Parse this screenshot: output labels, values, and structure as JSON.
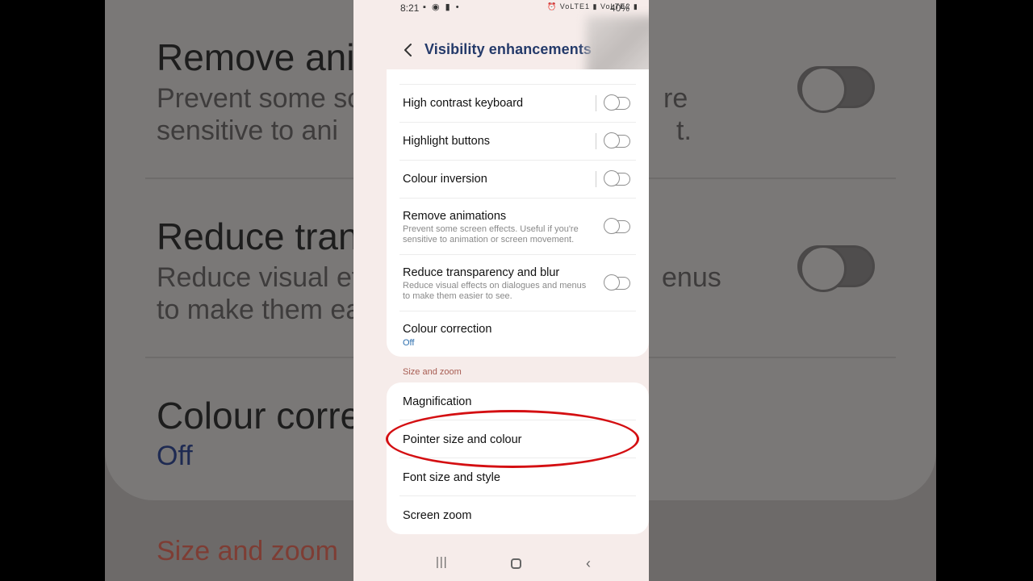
{
  "background": {
    "remove_title": "Remove ani",
    "remove_sub1": "Prevent some sc",
    "remove_sub1_end": "re",
    "remove_sub2": "sensitive to ani",
    "remove_sub2_end": "t.",
    "reduce_title": "Reduce tran",
    "reduce_sub1": "Reduce visual ef",
    "reduce_sub1_end": "enus",
    "reduce_sub2": "to make them ea",
    "colour_title": "Colour corre",
    "colour_val": "Off",
    "size_section": "Size and zoom"
  },
  "status_bar": {
    "time": "8:21",
    "left_icons": "▪ ◉ ▮ •",
    "right_icons": "⏰ VoLTE1 ▮ VoLTE2 ▮",
    "battery": "40%"
  },
  "header": {
    "title": "Visibility enhancements",
    "back_icon": "chevron-left-icon"
  },
  "visibility_list": [
    {
      "title": "High contrast keyboard",
      "toggle": false
    },
    {
      "title": "Highlight buttons",
      "toggle": false
    },
    {
      "title": "Colour inversion",
      "toggle": false
    },
    {
      "title": "Remove animations",
      "subtitle_line1": "Prevent some screen effects. Useful if you're",
      "subtitle_line2": "sensitive to animation or screen movement.",
      "toggle": false
    },
    {
      "title": "Reduce transparency and blur",
      "subtitle_line1": "Reduce visual effects on dialogues and menus",
      "subtitle_line2": "to make them easier to see.",
      "toggle": false
    },
    {
      "title": "Colour correction",
      "value": "Off"
    }
  ],
  "size_zoom": {
    "section_label": "Size and zoom",
    "items": [
      "Magnification",
      "Pointer size and colour",
      "Font size and style",
      "Screen zoom"
    ]
  },
  "annotation": {
    "highlight_color": "#d40f12"
  },
  "colors": {
    "accent": "#2d6fae",
    "title": "#243a6a",
    "section": "#a75c52"
  }
}
